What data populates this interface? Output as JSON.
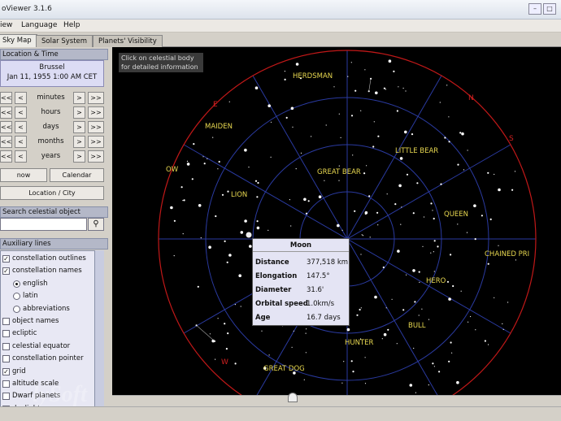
{
  "window": {
    "title": "oViewer 3.1.6"
  },
  "menu": [
    "iew",
    "Language",
    "Help"
  ],
  "tabs": [
    {
      "label": "Sky Map"
    },
    {
      "label": "Solar System"
    },
    {
      "label": "Planets' Visibility"
    }
  ],
  "location_time": {
    "header": "Location & Time",
    "city": "Brussel",
    "datetime": "Jan 11, 1955 1:00 AM CET",
    "steps": [
      {
        "label": "minutes"
      },
      {
        "label": "hours"
      },
      {
        "label": "days"
      },
      {
        "label": "months"
      },
      {
        "label": "years"
      }
    ],
    "buttons": {
      "back2": "<<",
      "back1": "<",
      "fwd1": ">",
      "fwd2": ">>"
    },
    "now_label": "now",
    "calendar_label": "Calendar",
    "location_city_label": "Location / City"
  },
  "search": {
    "header": "Search celestial object",
    "value": "",
    "icon": "search-icon"
  },
  "aux": {
    "header": "Auxiliary lines",
    "items": [
      {
        "label": "constellation outlines",
        "kind": "check",
        "checked": true
      },
      {
        "label": "constellation names",
        "kind": "check",
        "checked": true
      },
      {
        "label": "english",
        "kind": "radio",
        "checked": true
      },
      {
        "label": "latin",
        "kind": "radio",
        "checked": false
      },
      {
        "label": "abbreviations",
        "kind": "radio",
        "checked": false
      },
      {
        "label": "object names",
        "kind": "check",
        "checked": false
      },
      {
        "label": "ecliptic",
        "kind": "check",
        "checked": false
      },
      {
        "label": "celestial equator",
        "kind": "check",
        "checked": false
      },
      {
        "label": "constellation pointer",
        "kind": "check",
        "checked": false
      },
      {
        "label": "grid",
        "kind": "check",
        "checked": true
      },
      {
        "label": "altitude scale",
        "kind": "check",
        "checked": false
      },
      {
        "label": "Dwarf planets",
        "kind": "check",
        "checked": false
      },
      {
        "label": "daylight",
        "kind": "check",
        "checked": false
      }
    ]
  },
  "sky": {
    "hint_line1": "Click on celestial body",
    "hint_line2": "for detailed information",
    "constellations": [
      "HERDSMAN",
      "MAIDEN",
      "LITTLE BEAR",
      "GREAT BEAR",
      "LION",
      "QUEEN",
      "CHAINED PRI",
      "HERO",
      "BULL",
      "HUNTER",
      "GREAT DOG",
      "OW"
    ],
    "directions": [
      "E",
      "N",
      "S",
      "W"
    ],
    "colors": {
      "sky": "#000000",
      "horizon": "#c01818",
      "grid": "#2a3aa0",
      "lines": "#b8b8b8",
      "labels": "#e8d850"
    }
  },
  "popup": {
    "title": "Moon",
    "rows": [
      {
        "key": "Distance",
        "value": "377,518 km"
      },
      {
        "key": "Elongation",
        "value": "147.5°"
      },
      {
        "key": "Diameter",
        "value": "31.6'"
      },
      {
        "key": "Orbital speed",
        "value": "1.0km/s"
      },
      {
        "key": "Age",
        "value": "16.7 days"
      }
    ]
  },
  "watermark": "lySoft"
}
